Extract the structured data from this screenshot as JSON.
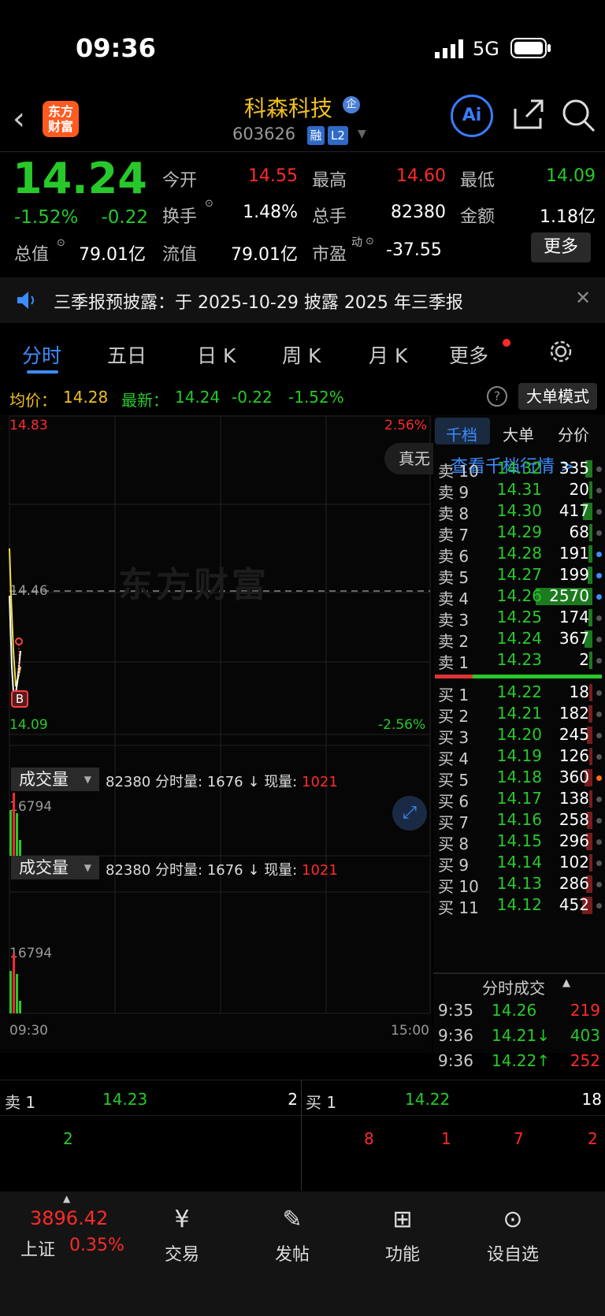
{
  "status": {
    "time": "09:36",
    "network": "5G"
  },
  "header": {
    "logo_line1": "东方",
    "logo_line2": "财富",
    "stock_name": "科森科技",
    "badge": "企",
    "stock_code": "603626",
    "tag_margin": "融",
    "tag_level": "L2",
    "ai_label": "Ai"
  },
  "quote": {
    "price": "14.24",
    "change_pct": "-1.52%",
    "change": "-0.22",
    "open_label": "今开",
    "open": "14.55",
    "high_label": "最高",
    "high": "14.60",
    "low_label": "最低",
    "low": "14.09",
    "turnover_label": "换手",
    "turnover": "1.48%",
    "volume_label": "总手",
    "volume": "82380",
    "amount_label": "金额",
    "amount": "1.18亿",
    "mktcap_label": "总值",
    "mktcap": "79.01亿",
    "float_label": "流值",
    "float": "79.01亿",
    "pe_label": "市盈",
    "pe_sup": "动",
    "pe": "-37.55",
    "more": "更多"
  },
  "notice": {
    "text": "三季报预披露：于 2025-10-29 披露 2025 年三季报"
  },
  "tabs": [
    "分时",
    "五日",
    "日 K",
    "周 K",
    "月 K",
    "更多"
  ],
  "infoline": {
    "avg_label": "均价：",
    "avg": "14.28",
    "latest_label": "最新：",
    "latest": "14.24",
    "change": "-0.22",
    "pct": "-1.52%",
    "mode": "大单模式"
  },
  "chart_data": {
    "type": "line",
    "y_max": "14.83",
    "y_mid": "14.46",
    "y_min": "14.09",
    "pct_max": "2.56%",
    "pct_min": "-2.56%",
    "x_start": "09:30",
    "x_end": "15:00",
    "float_btn": "真无",
    "watermark": "东方财富",
    "marker": "B",
    "vol_label": "成交量",
    "vol_total": "82380",
    "vol_min_label": "分时量:",
    "vol_min": "1676",
    "vol_arrow": "↓",
    "vol_now_label": "现量:",
    "vol_now": "1021",
    "vol_max": "16794"
  },
  "book": {
    "tabs": [
      "千档",
      "大单",
      "分价"
    ],
    "link": "查看千档行情 >",
    "asks": [
      {
        "label": "卖 10",
        "price": "14.32",
        "vol": "335"
      },
      {
        "label": "卖 9",
        "price": "14.31",
        "vol": "20"
      },
      {
        "label": "卖 8",
        "price": "14.30",
        "vol": "417"
      },
      {
        "label": "卖 7",
        "price": "14.29",
        "vol": "68"
      },
      {
        "label": "卖 6",
        "price": "14.28",
        "vol": "191"
      },
      {
        "label": "卖 5",
        "price": "14.27",
        "vol": "199"
      },
      {
        "label": "卖 4",
        "price": "14.26",
        "vol": "2570"
      },
      {
        "label": "卖 3",
        "price": "14.25",
        "vol": "174"
      },
      {
        "label": "卖 2",
        "price": "14.24",
        "vol": "367"
      },
      {
        "label": "卖 1",
        "price": "14.23",
        "vol": "2"
      }
    ],
    "bids": [
      {
        "label": "买 1",
        "price": "14.22",
        "vol": "18"
      },
      {
        "label": "买 2",
        "price": "14.21",
        "vol": "182"
      },
      {
        "label": "买 3",
        "price": "14.20",
        "vol": "245"
      },
      {
        "label": "买 4",
        "price": "14.19",
        "vol": "126"
      },
      {
        "label": "买 5",
        "price": "14.18",
        "vol": "360"
      },
      {
        "label": "买 6",
        "price": "14.17",
        "vol": "138"
      },
      {
        "label": "买 7",
        "price": "14.16",
        "vol": "258"
      },
      {
        "label": "买 8",
        "price": "14.15",
        "vol": "296"
      },
      {
        "label": "买 9",
        "price": "14.14",
        "vol": "102"
      },
      {
        "label": "买 10",
        "price": "14.13",
        "vol": "286"
      },
      {
        "label": "买 11",
        "price": "14.12",
        "vol": "452"
      }
    ],
    "trades_title": "分时成交",
    "trades": [
      {
        "time": "9:35",
        "price": "14.26",
        "arrow": "",
        "vol": "219",
        "side": "red"
      },
      {
        "time": "9:36",
        "price": "14.21",
        "arrow": "↓",
        "vol": "403",
        "side": "green"
      },
      {
        "time": "9:36",
        "price": "14.22",
        "arrow": "↑",
        "vol": "252",
        "side": "red"
      }
    ]
  },
  "strip": {
    "ask_label": "卖 1",
    "ask_price": "14.23",
    "ask_vol": "2",
    "bid_label": "买 1",
    "bid_price": "14.22",
    "bid_vol": "18",
    "left_queue": [
      "2"
    ],
    "right_queue": [
      "8",
      "1",
      "7",
      "2"
    ]
  },
  "tabbar": {
    "index_value": "3896.42",
    "index_name": "上证",
    "index_pct": "0.35%",
    "items": [
      "交易",
      "发帖",
      "功能",
      "设自选"
    ]
  }
}
